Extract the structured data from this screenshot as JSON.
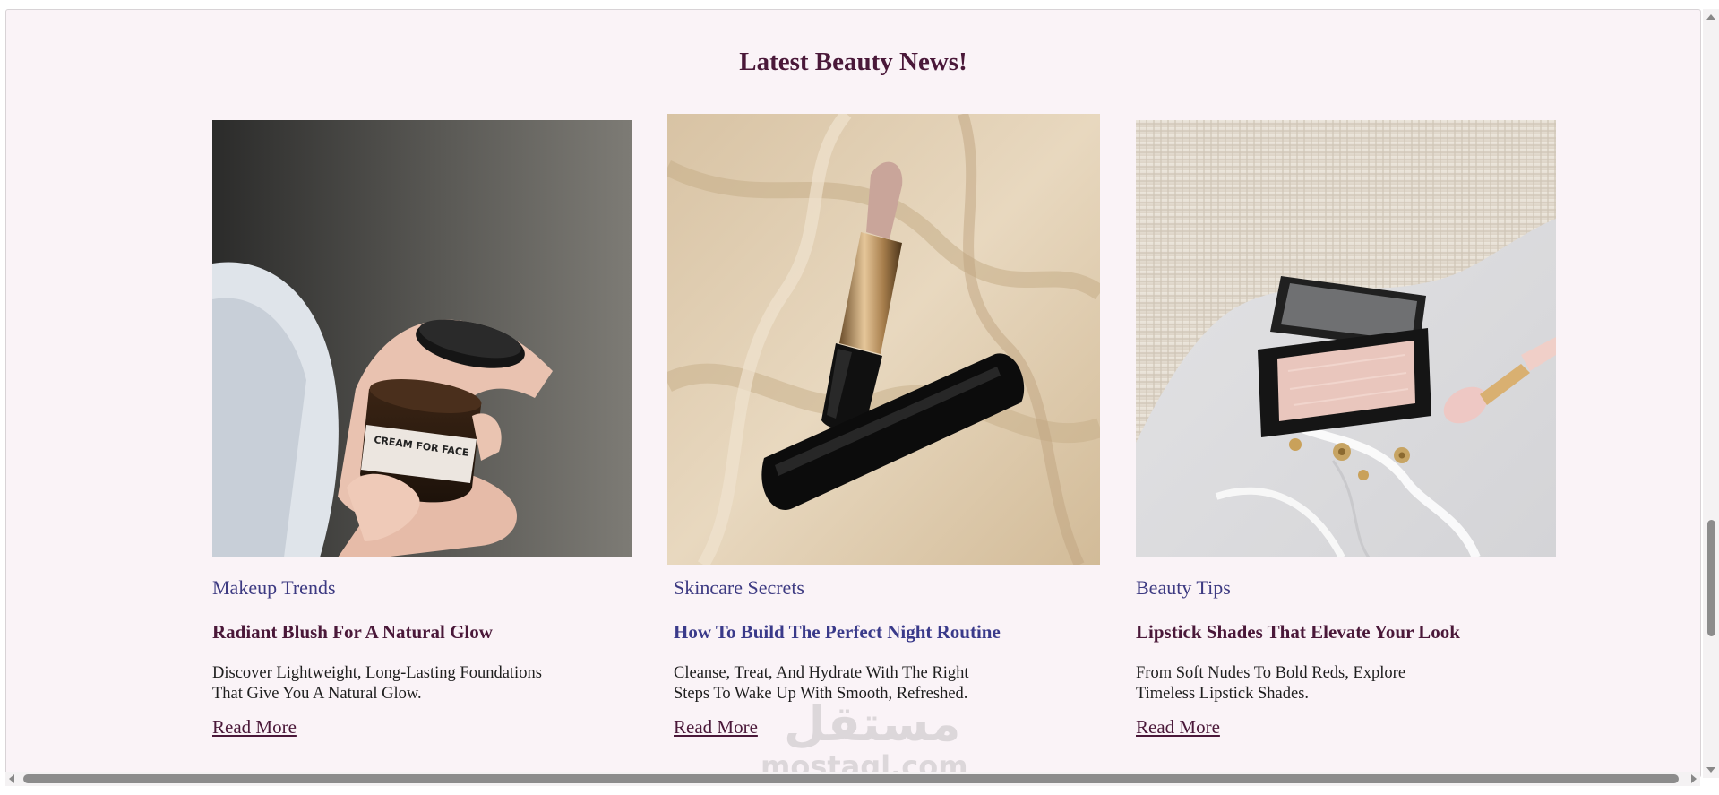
{
  "section": {
    "title": "Latest Beauty News!"
  },
  "cards": [
    {
      "category": "Makeup Trends",
      "title": "Radiant Blush For A Natural Glow",
      "desc_line1": "Discover Lightweight, Long-Lasting Foundations",
      "desc_line2": "That Give You A Natural Glow.",
      "read_more": "Read More",
      "image_alt": "Hands holding a jar labeled CREAM FOR FACE",
      "image_label": "CREAM FOR FACE"
    },
    {
      "category": "Skincare Secrets",
      "title": "How To Build The Perfect Night Routine",
      "desc_line1": "Cleanse, Treat, And Hydrate With The Right",
      "desc_line2": "Steps To Wake Up With Smooth, Refreshed.",
      "read_more": "Read More",
      "image_alt": "Nude lipstick with black cap on beige silk fabric"
    },
    {
      "category": "Beauty Tips",
      "title": "Lipstick Shades That Elevate Your Look",
      "desc_line1": "From Soft Nudes To Bold Reds, Explore",
      "desc_line2": "Timeless Lipstick Shades.",
      "read_more": "Read More",
      "image_alt": "Open blush compact, gold earrings and rose quartz roller on marble"
    }
  ],
  "watermark": {
    "arabic": "مستقل",
    "latin": "mostaql.com"
  },
  "colors": {
    "page_bg": "#faf3f7",
    "heading": "#4a1839",
    "category": "#3d3a82",
    "title_alt": "#3a3a8a",
    "body_text": "#1e1e1e"
  }
}
